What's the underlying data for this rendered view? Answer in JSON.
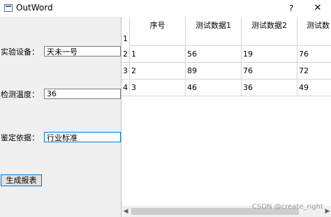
{
  "window": {
    "title": "OutWord",
    "help_label": "?",
    "close_label": "✕"
  },
  "form": {
    "device_label": "实验设备：",
    "device_value": "天未一号",
    "temp_label": "检测温度：",
    "temp_value": "36",
    "basis_label": "鉴定依据：",
    "basis_value": "行业标准",
    "generate_label": "生成报表"
  },
  "table": {
    "columns": [
      "序号",
      "测试数据1",
      "测试数据2",
      "测试数"
    ],
    "row_headers": [
      "1",
      "2",
      "3",
      "4"
    ],
    "rows": [
      [
        "",
        "",
        "",
        ""
      ],
      [
        "1",
        "56",
        "19",
        "76"
      ],
      [
        "2",
        "89",
        "76",
        "72"
      ],
      [
        "3",
        "46",
        "36",
        "49"
      ]
    ]
  },
  "scrollbar": {
    "left_arrow": "◀",
    "right_arrow": "▶"
  },
  "watermark": "CSDN @create_right"
}
